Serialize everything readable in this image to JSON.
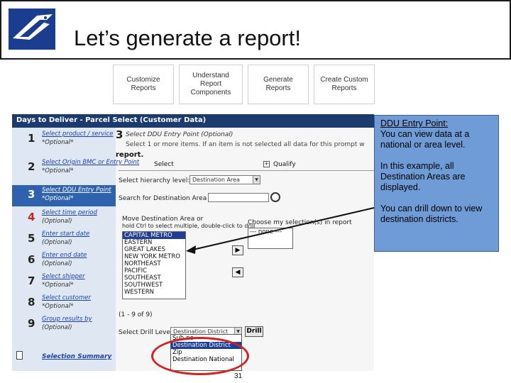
{
  "slide": {
    "title": "Let’s generate a report!",
    "page_number": "31"
  },
  "steps": [
    {
      "label": "Customize Reports"
    },
    {
      "label": "Understand Report Components"
    },
    {
      "label": "Generate Reports"
    },
    {
      "label": "Create Custom Reports"
    }
  ],
  "report_screen": {
    "window_title": "Days to Deliver - Parcel Select (Customer Data)",
    "sidebar": {
      "items": [
        {
          "num": "1",
          "link": "Select product / service",
          "opt": "*Optional*"
        },
        {
          "num": "2",
          "link": "Select Origin BMC or Entry Point",
          "opt": "*Optional*"
        },
        {
          "num": "3",
          "link": "Select DDU Entry Point",
          "opt": "*Optional*"
        },
        {
          "num": "4",
          "link": "Select time period",
          "opt": "(Optional)"
        },
        {
          "num": "5",
          "link": "Enter start date",
          "opt": "(Optional)"
        },
        {
          "num": "6",
          "link": "Enter end date",
          "opt": "(Optional)"
        },
        {
          "num": "7",
          "link": "Select shipper",
          "opt": "*Optional*"
        },
        {
          "num": "8",
          "link": "Select customer",
          "opt": "*Optional*"
        },
        {
          "num": "9",
          "link": "Group results by",
          "opt": "(Optional)"
        }
      ],
      "summary_link": "Selection Summary"
    },
    "main": {
      "step_num": "3",
      "heading": "Select DDU Entry Point (Optional)",
      "instruction": "Select 1 or more items. If an item is not selected all data for this prompt w",
      "report_word": "report.",
      "tab_select": "Select",
      "tab_qualify": "Qualify",
      "hierarchy_label": "Select hierarchy level:",
      "hierarchy_value": "Destination Area",
      "search_label": "Search for Destination Area",
      "move_label_1": "Move Destination Area or",
      "move_label_2": "hold Ctrl to select multiple, double-click to drill",
      "chosen_label": "Choose my selection(s) in report",
      "chosen_empty": "--- none ---",
      "areas": [
        "CAPITAL METRO",
        "EASTERN",
        "GREAT LAKES",
        "NEW YORK METRO",
        "NORTHEAST",
        "PACIFIC",
        "SOUTHEAST",
        "SOUTHWEST",
        "WESTERN"
      ],
      "count_text": "(1 - 9 of 9)",
      "drill_label": "Select Drill Level:",
      "drill_value": "Destination District",
      "drill_button": "Drill",
      "drill_options": [
        "Sub-no",
        "Destination District",
        "Zip",
        "Destination National"
      ]
    }
  },
  "callout": {
    "title": "DDU Entry Point:",
    "line1": "You can view data at a national or area level.",
    "para2": "In this example, all Destination Areas are displayed.",
    "para3": "You can drill down to view destination districts."
  },
  "colors": {
    "callout_bg": "#6f9bd6",
    "title_bar": "#1b3a6e",
    "active_item": "#2f62ad",
    "highlight": "#d62020"
  }
}
